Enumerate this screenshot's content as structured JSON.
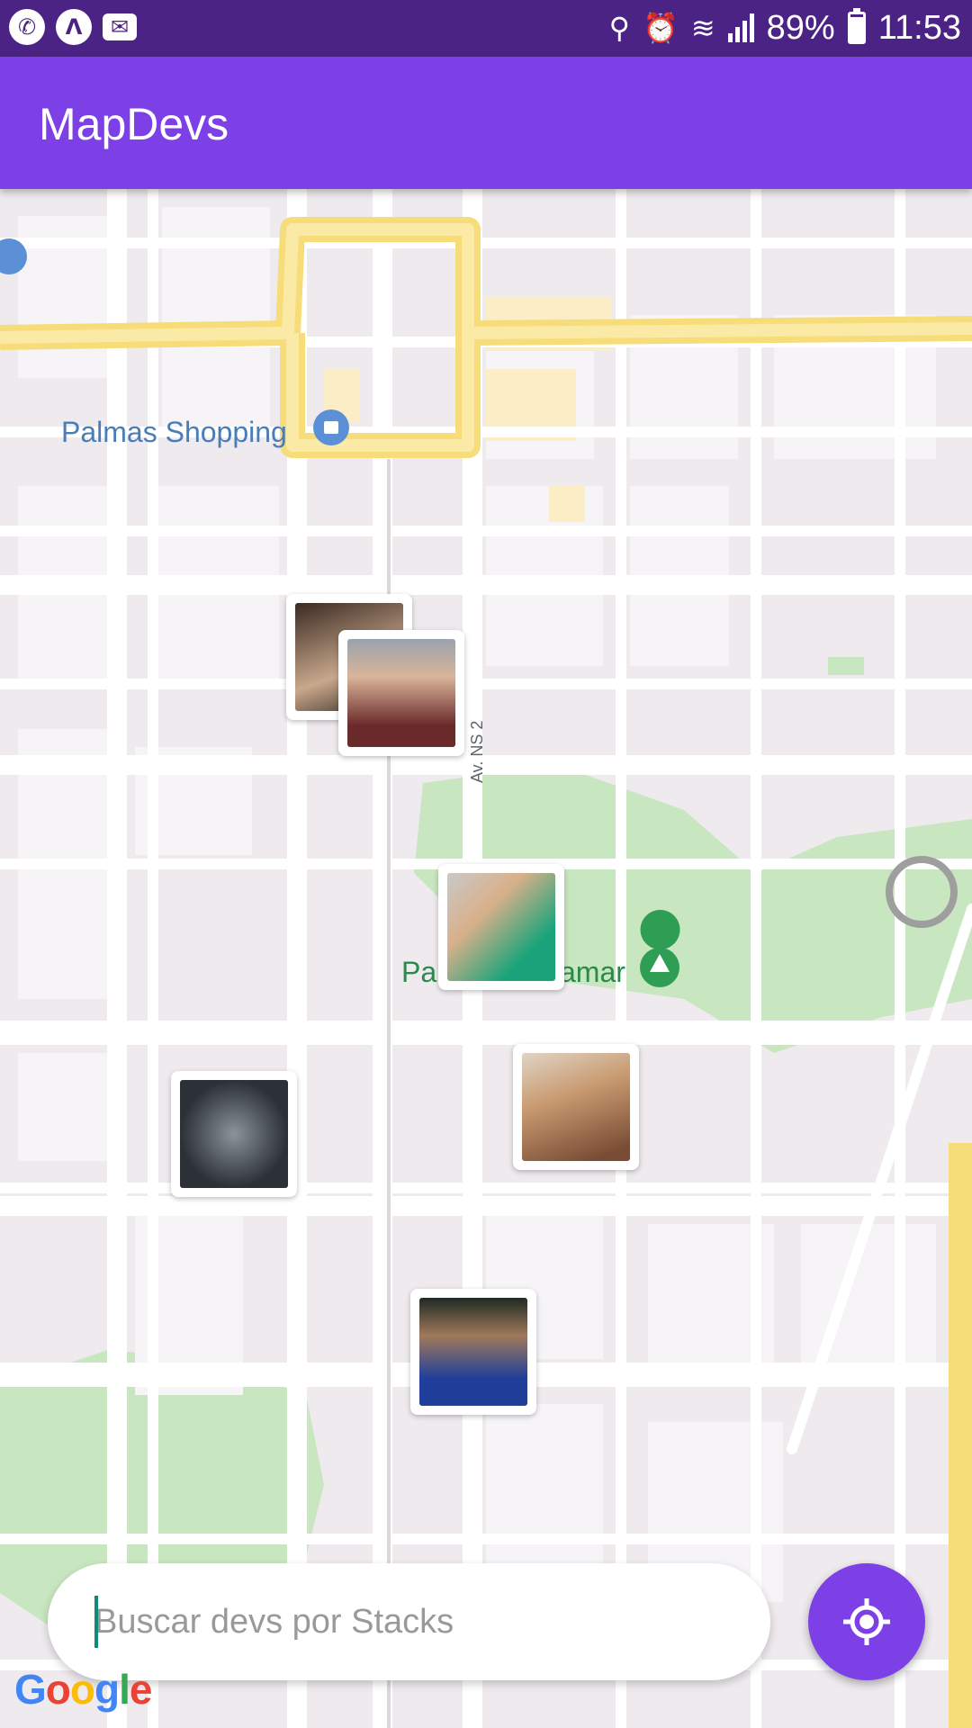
{
  "status_bar": {
    "battery_percent": "89%",
    "time": "11:53",
    "battery_level": 0.89
  },
  "app_bar": {
    "title": "MapDevs"
  },
  "map": {
    "place_labels": {
      "shopping": "Palmas Shopping",
      "park": "Pa",
      "park_suffix": "amar",
      "street": "Av. NS 2"
    },
    "markers": [
      {
        "id": "dev-1",
        "colors": [
          "#3a2a22",
          "#c9a88c"
        ]
      },
      {
        "id": "dev-2",
        "colors": [
          "#6a2a2a",
          "#d9b49a"
        ]
      },
      {
        "id": "dev-3",
        "colors": [
          "#1aa37a",
          "#d8b08a"
        ]
      },
      {
        "id": "dev-4",
        "colors": [
          "#2b3136",
          "#8c9399"
        ]
      },
      {
        "id": "dev-5",
        "colors": [
          "#7a4c35",
          "#c89a70"
        ]
      },
      {
        "id": "dev-6",
        "colors": [
          "#1f3f9a",
          "#2a2a2a"
        ]
      }
    ],
    "attribution": "Google"
  },
  "search": {
    "placeholder": "Buscar devs por Stacks",
    "value": ""
  },
  "colors": {
    "status_bar": "#4b2384",
    "app_bar": "#7d40e7",
    "accent": "#7d40e7"
  }
}
